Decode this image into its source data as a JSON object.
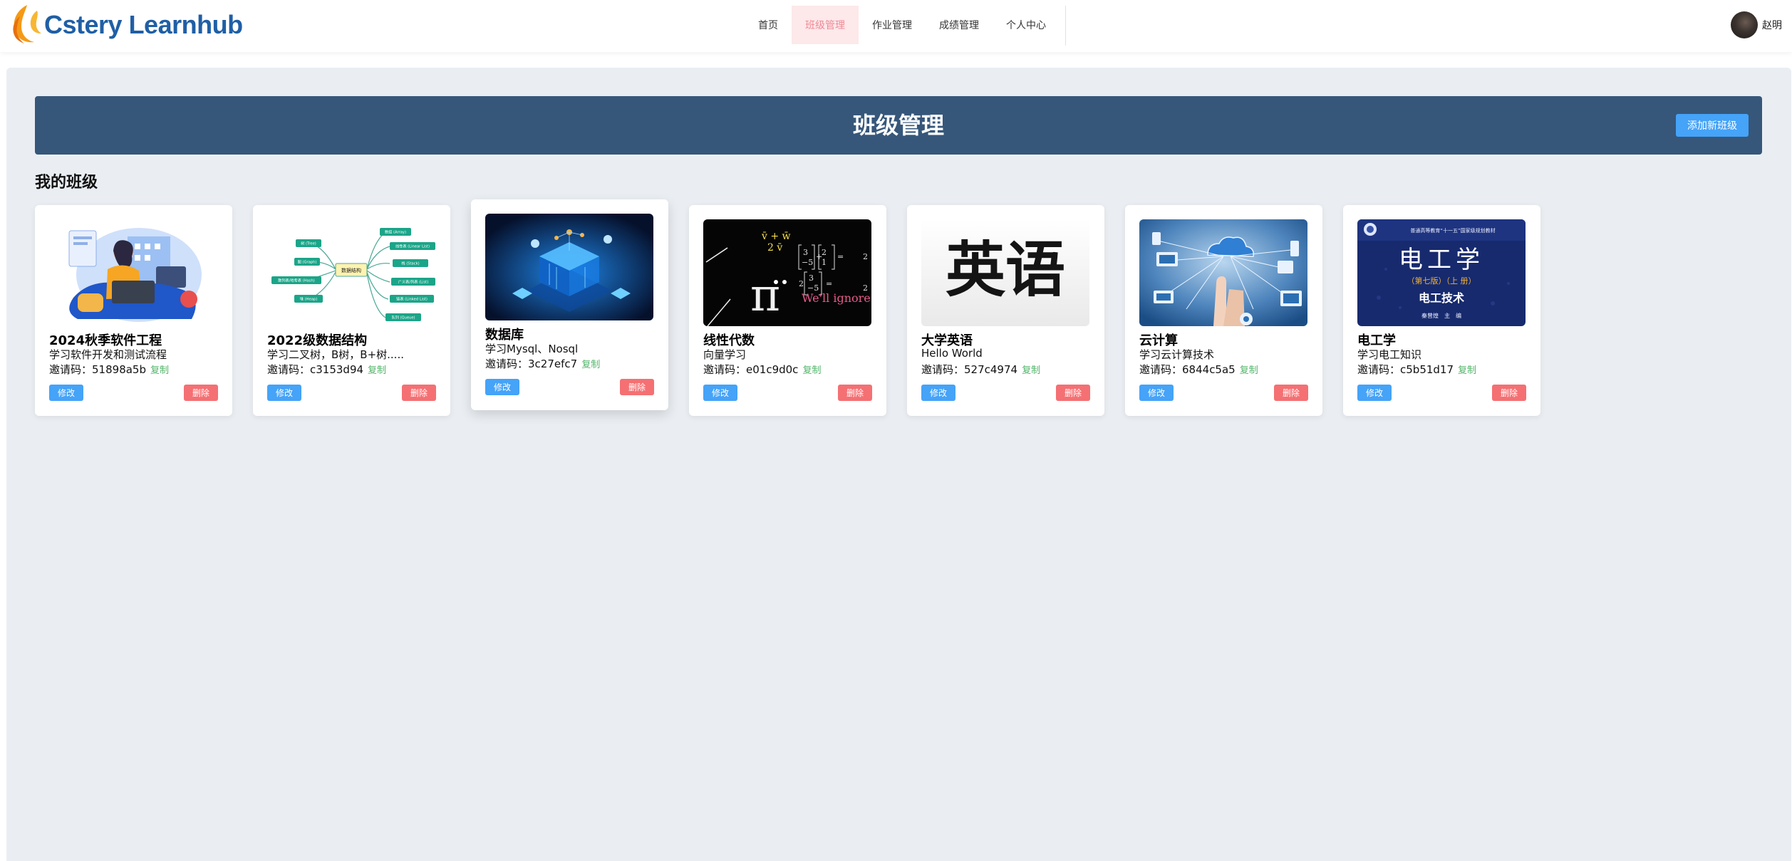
{
  "header": {
    "logo_text": "Cstery Learnhub",
    "nav": [
      {
        "label": "首页",
        "active": false
      },
      {
        "label": "班级管理",
        "active": true
      },
      {
        "label": "作业管理",
        "active": false
      },
      {
        "label": "成绩管理",
        "active": false
      },
      {
        "label": "个人中心",
        "active": false
      }
    ],
    "user_name": "赵明"
  },
  "banner": {
    "title": "班级管理",
    "add_button": "添加新班级"
  },
  "section_title": "我的班级",
  "code_prefix": "邀请码：",
  "copy_label": "复制",
  "edit_label": "修改",
  "delete_label": "删除",
  "classes": [
    {
      "name": "2024秋季软件工程",
      "desc": "学习软件开发和测试流程",
      "code": "51898a5b",
      "thumb": "person-laptop-illustration"
    },
    {
      "name": "2022级数据结构",
      "desc": "学习二叉树，B树，B+树.....",
      "code": "c3153d94",
      "thumb": "mind-map",
      "thumb_text": {
        "center": "数据结构",
        "left": [
          "树 (Tree)",
          "图 (Graph)",
          "散列表/哈希表 (Hash)",
          "堆 (Heap)"
        ],
        "right": [
          "数组 (Array)",
          "线性表 (Linear List)",
          "栈 (Stack)",
          "广义表/列表 (List)",
          "链表 (Linked List)",
          "队列 (Queue)"
        ]
      }
    },
    {
      "name": "数据库",
      "desc": "学习Mysql、Nosql",
      "code": "3c27efc7",
      "thumb": "database-isometric"
    },
    {
      "name": "线性代数",
      "desc": "向量学习",
      "code": "e01c9d0c",
      "thumb": "math-chalkboard",
      "thumb_text": {
        "caption": "We'll ignore for now"
      }
    },
    {
      "name": "大学英语",
      "desc": "Hello World",
      "code": "527c4974",
      "thumb": "calligraphy",
      "thumb_text": {
        "calligraphy": "英语"
      }
    },
    {
      "name": "云计算",
      "desc": "学习云计算技术",
      "code": "6844c5a5",
      "thumb": "cloud-network"
    },
    {
      "name": "电工学",
      "desc": "学习电工知识",
      "code": "c5b51d17",
      "thumb": "book-cover",
      "thumb_text": {
        "series": "普通高等教育“十一五”国家级规划教材",
        "title": "电工学",
        "edition": "（第七版）（上 册）",
        "subtitle": "电工技术",
        "author": "秦曾煌　主　编"
      }
    }
  ],
  "colors": {
    "banner_bg": "#36577a",
    "primary": "#45a3f8",
    "danger": "#f47073",
    "copy_green": "#52b46a",
    "nav_active_bg": "#fde8ea",
    "nav_active_text": "#f08a96",
    "logo_blue": "#1f5fa6",
    "page_bg": "#eaeef2"
  }
}
